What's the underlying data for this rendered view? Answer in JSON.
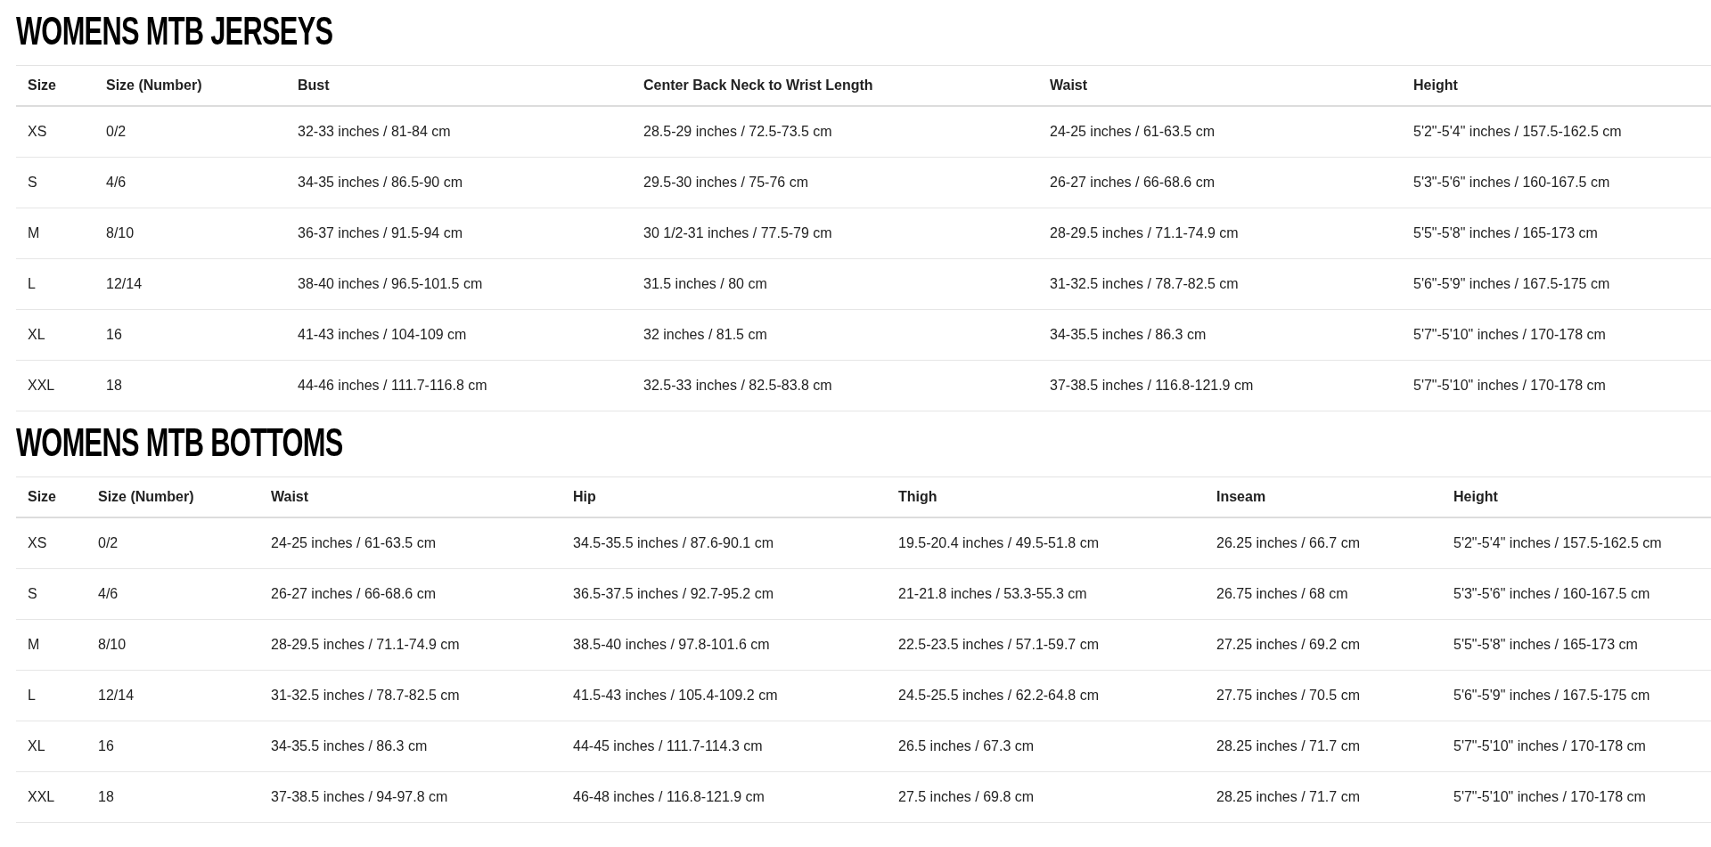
{
  "sections": [
    {
      "title": "WOMENS MTB JERSEYS",
      "columns": [
        "Size",
        "Size (Number)",
        "Bust",
        "Center Back Neck to Wrist Length",
        "Waist",
        "Height"
      ],
      "rows": [
        [
          "XS",
          "0/2",
          "32-33 inches / 81-84 cm",
          "28.5-29 inches / 72.5-73.5 cm",
          "24-25 inches / 61-63.5 cm",
          "5'2\"-5'4\" inches / 157.5-162.5 cm"
        ],
        [
          "S",
          "4/6",
          "34-35 inches / 86.5-90 cm",
          "29.5-30 inches / 75-76 cm",
          "26-27 inches / 66-68.6 cm",
          "5'3\"-5'6\" inches / 160-167.5 cm"
        ],
        [
          "M",
          "8/10",
          "36-37 inches / 91.5-94 cm",
          "30 1/2-31 inches / 77.5-79 cm",
          "28-29.5 inches / 71.1-74.9 cm",
          "5'5\"-5'8\" inches / 165-173 cm"
        ],
        [
          "L",
          "12/14",
          "38-40 inches / 96.5-101.5 cm",
          "31.5 inches / 80 cm",
          "31-32.5 inches / 78.7-82.5 cm",
          "5'6\"-5'9\" inches / 167.5-175 cm"
        ],
        [
          "XL",
          "16",
          "41-43 inches / 104-109 cm",
          "32 inches / 81.5 cm",
          "34-35.5 inches / 86.3 cm",
          "5'7\"-5'10\" inches / 170-178 cm"
        ],
        [
          "XXL",
          "18",
          "44-46 inches / 111.7-116.8 cm",
          "32.5-33 inches / 82.5-83.8 cm",
          "37-38.5 inches / 116.8-121.9 cm",
          "5'7\"-5'10\" inches / 170-178 cm"
        ]
      ]
    },
    {
      "title": "WOMENS MTB BOTTOMS",
      "columns": [
        "Size",
        "Size (Number)",
        "Waist",
        "Hip",
        "Thigh",
        "Inseam",
        "Height"
      ],
      "rows": [
        [
          "XS",
          "0/2",
          "24-25 inches / 61-63.5 cm",
          "34.5-35.5 inches / 87.6-90.1 cm",
          "19.5-20.4 inches / 49.5-51.8 cm",
          "26.25 inches / 66.7 cm",
          "5'2\"-5'4\" inches / 157.5-162.5 cm"
        ],
        [
          "S",
          "4/6",
          "26-27 inches / 66-68.6 cm",
          "36.5-37.5 inches / 92.7-95.2 cm",
          "21-21.8 inches / 53.3-55.3 cm",
          "26.75 inches / 68 cm",
          "5'3\"-5'6\" inches / 160-167.5 cm"
        ],
        [
          "M",
          "8/10",
          "28-29.5 inches / 71.1-74.9 cm",
          "38.5-40 inches / 97.8-101.6 cm",
          "22.5-23.5 inches / 57.1-59.7 cm",
          "27.25 inches / 69.2 cm",
          "5'5\"-5'8\" inches / 165-173 cm"
        ],
        [
          "L",
          "12/14",
          "31-32.5 inches / 78.7-82.5 cm",
          "41.5-43 inches / 105.4-109.2 cm",
          "24.5-25.5 inches / 62.2-64.8 cm",
          "27.75 inches / 70.5 cm",
          "5'6\"-5'9\" inches / 167.5-175 cm"
        ],
        [
          "XL",
          "16",
          "34-35.5 inches / 86.3 cm",
          "44-45 inches / 111.7-114.3 cm",
          "26.5 inches / 67.3 cm",
          "28.25 inches / 71.7 cm",
          "5'7\"-5'10\" inches / 170-178 cm"
        ],
        [
          "XXL",
          "18",
          "37-38.5 inches / 94-97.8 cm",
          "46-48 inches / 116.8-121.9 cm",
          "27.5 inches / 69.8 cm",
          "28.25 inches / 71.7 cm",
          "5'7\"-5'10\" inches / 170-178 cm"
        ]
      ]
    }
  ]
}
